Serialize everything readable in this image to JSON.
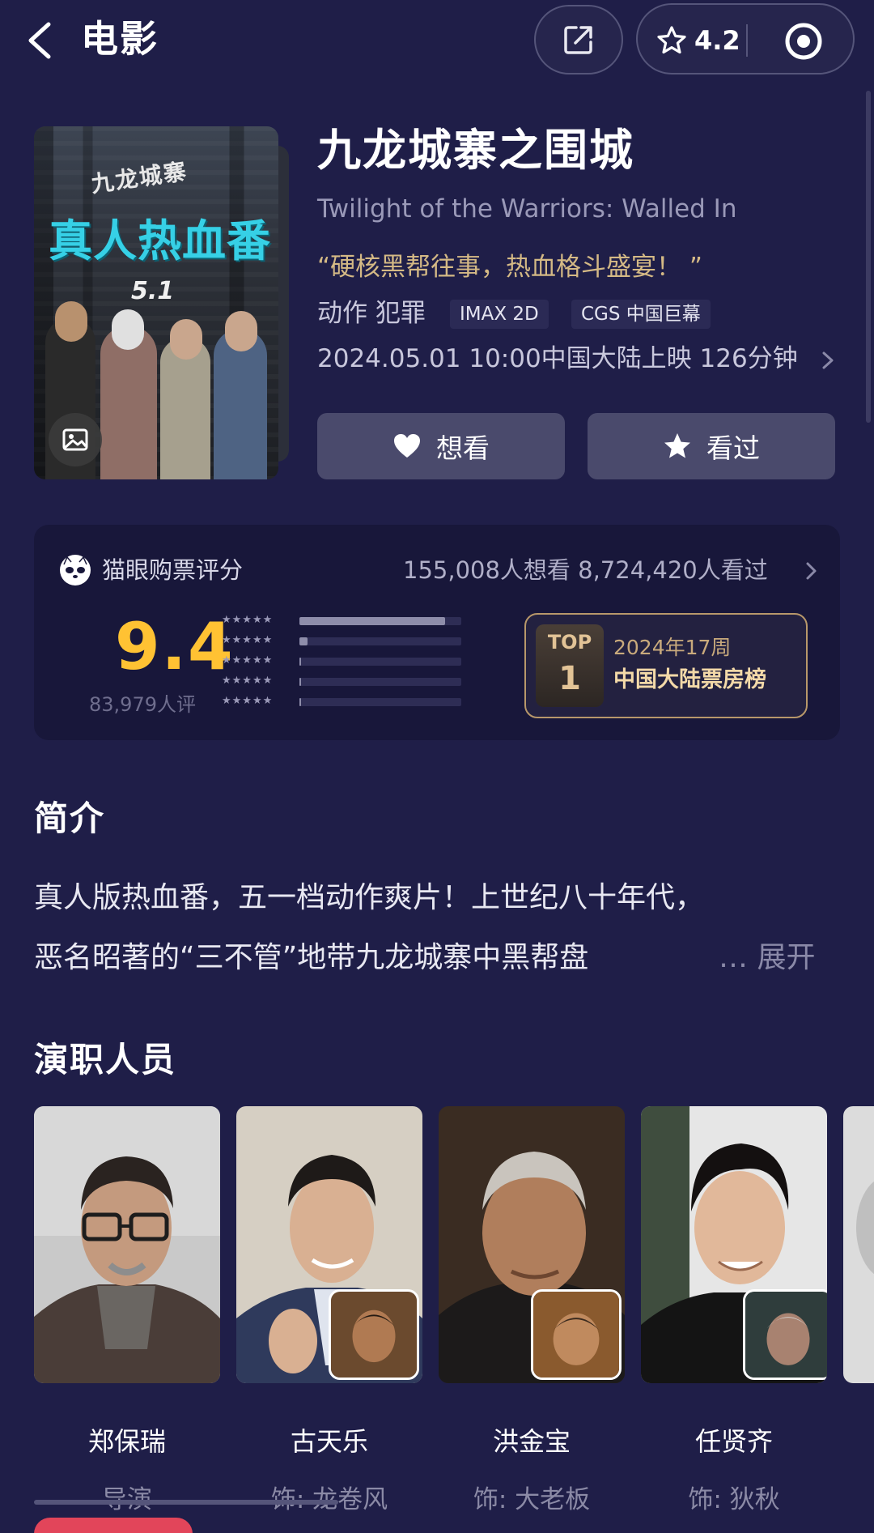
{
  "header": {
    "title": "电影",
    "rating_value": "4.2"
  },
  "movie": {
    "title": "九龙城寨之围城",
    "english_title": "Twilight of the Warriors: Walled In",
    "tagline": "“硬核黑帮往事，热血格斗盛宴！ ”",
    "genres": "动作 犯罪",
    "format_tag": "IMAX  2D",
    "screen_tag": "CGS 中国巨幕",
    "release": "2024.05.01 10:00中国大陆上映 126分钟",
    "poster": {
      "logo_text": "九龙城寨",
      "headline": "真人热血番",
      "date_mark": "5.1"
    }
  },
  "actions": {
    "want_label": "想看",
    "seen_label": "看过"
  },
  "rating": {
    "label": "猫眼购票评分",
    "counts": "155,008人想看 8,724,420人看过",
    "score": "9.4",
    "score_count": "83,979人评",
    "distribution": [
      {
        "stars": "★★★★★",
        "fraction": 0.9
      },
      {
        "stars": "★★★★★",
        "fraction": 0.05
      },
      {
        "stars": "★★★★★",
        "fraction": 0.01
      },
      {
        "stars": "★★★★★",
        "fraction": 0.01
      },
      {
        "stars": "★★★★★",
        "fraction": 0.01
      }
    ],
    "top_badge": {
      "top_label": "TOP",
      "rank": "1",
      "week": "2024年17周",
      "board": "中国大陆票房榜"
    }
  },
  "synopsis": {
    "title": "简介",
    "line1": "真人版热血番，五一档动作爽片！上世纪八十年代，",
    "line2": "恶名昭著的“三不管”地带九龙城寨中黑帮盘",
    "more": "… 展开"
  },
  "cast": {
    "title": "演职人员",
    "members": [
      {
        "name": "郑保瑞",
        "role": "导演"
      },
      {
        "name": "古天乐",
        "role": "饰: 龙卷风"
      },
      {
        "name": "洪金宝",
        "role": "饰: 大老板"
      },
      {
        "name": "任贤齐",
        "role": "饰: 狄秋"
      }
    ]
  },
  "colors": {
    "background": "#1f1e48",
    "score": "#ffc233",
    "gold": "#b8986a"
  }
}
